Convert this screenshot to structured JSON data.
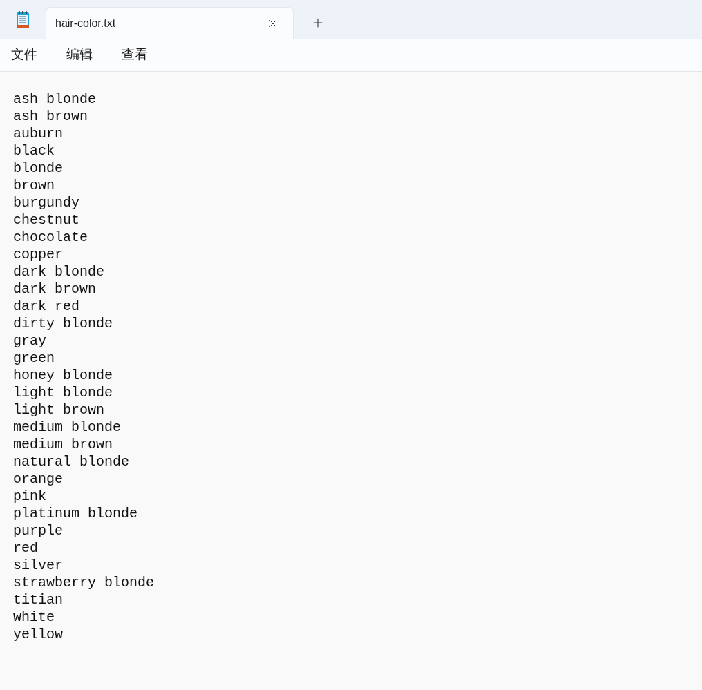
{
  "tab": {
    "title": "hair-color.txt",
    "selected": true
  },
  "menu": [
    "文件",
    "编辑",
    "查看"
  ],
  "lines": [
    "ash blonde",
    "ash brown",
    "auburn",
    "black",
    "blonde",
    "brown",
    "burgundy",
    "chestnut",
    "chocolate",
    "copper",
    "dark blonde",
    "dark brown",
    "dark red",
    "dirty blonde",
    "gray",
    "green",
    "honey blonde",
    "light blonde",
    "light brown",
    "medium blonde",
    "medium brown",
    "natural blonde",
    "orange",
    "pink",
    "platinum blonde",
    "purple",
    "red",
    "silver",
    "strawberry blonde",
    "titian",
    "white",
    "yellow"
  ]
}
